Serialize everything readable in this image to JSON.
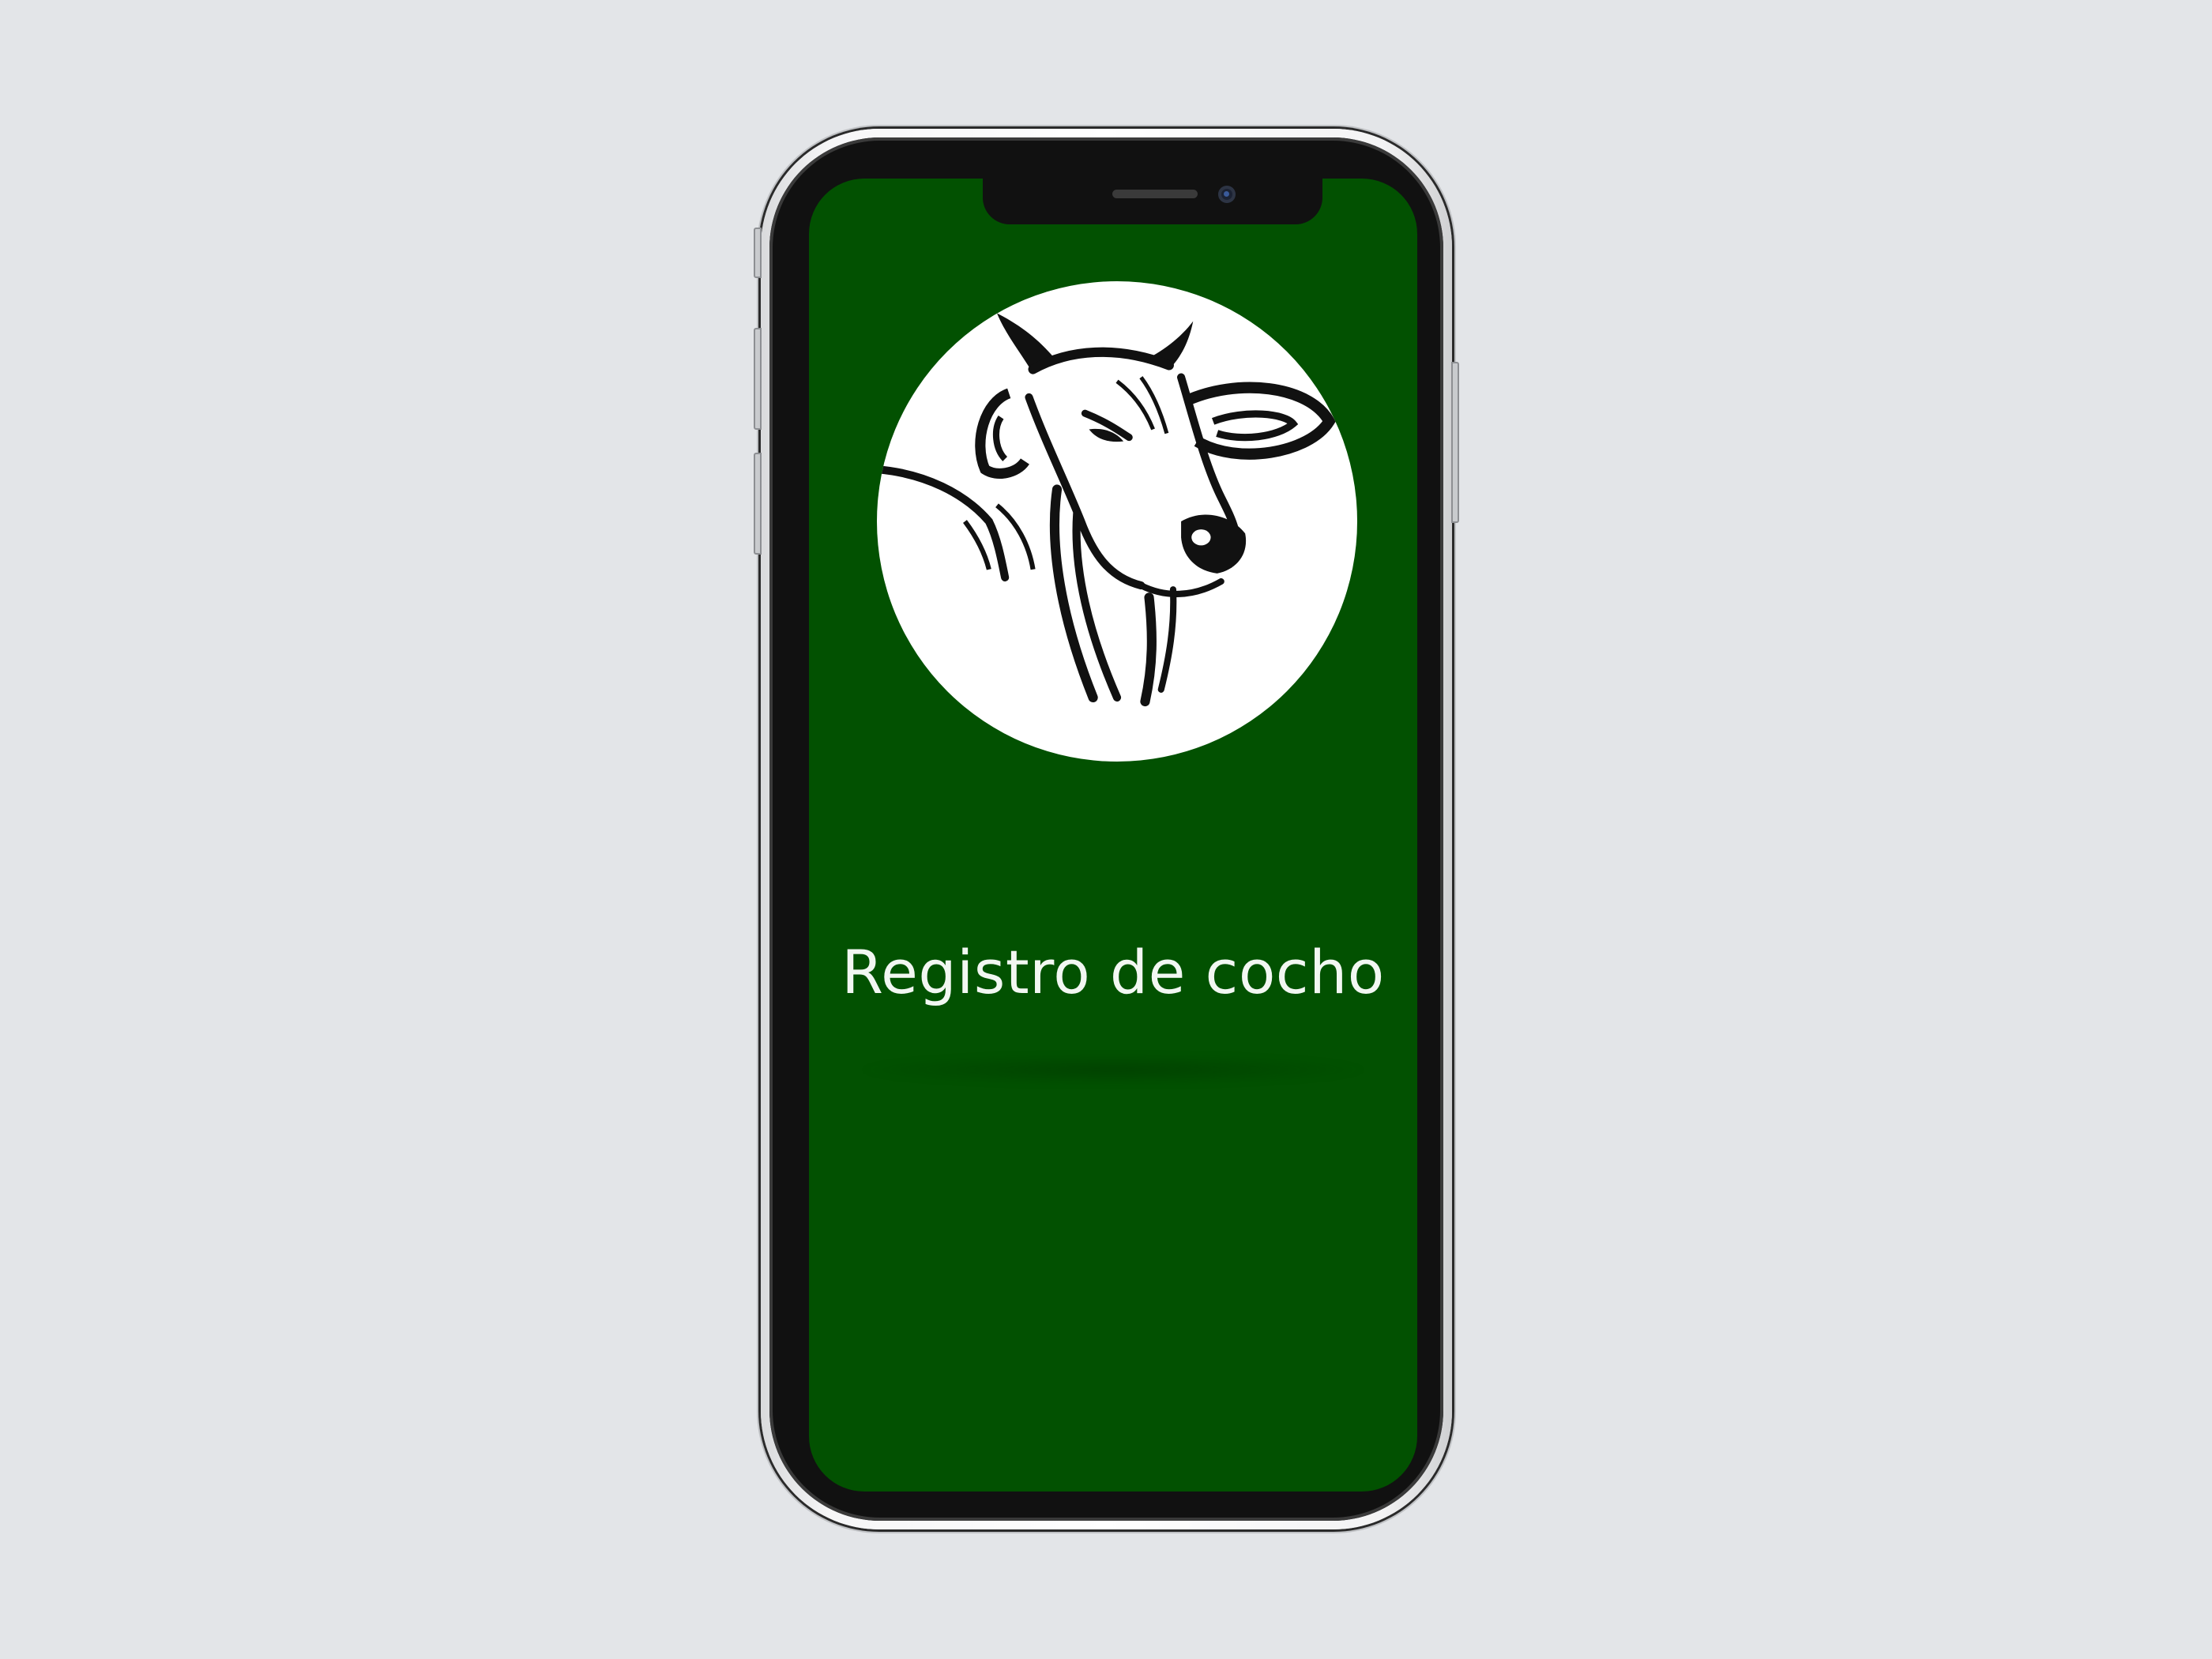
{
  "app": {
    "title": "Registro de cocho",
    "logo_icon": "cow-head-icon"
  },
  "colors": {
    "screen_background": "#025101",
    "page_background": "#e3e5e8",
    "logo_circle": "#ffffff",
    "title_text": "#f2f7f2"
  }
}
